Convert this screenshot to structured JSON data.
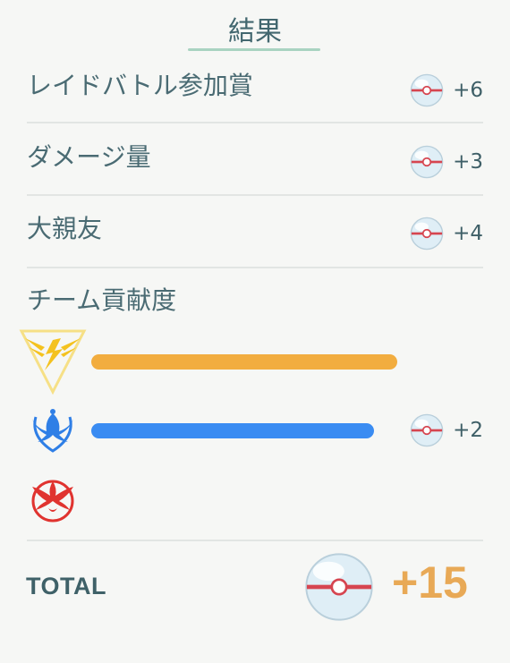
{
  "header": {
    "title": "結果"
  },
  "rows": [
    {
      "label": "レイドバトル参加賞",
      "amount": "+6",
      "icon": "premier-ball-icon"
    },
    {
      "label": "ダメージ量",
      "amount": "+3",
      "icon": "premier-ball-icon"
    },
    {
      "label": "大親友",
      "amount": "+4",
      "icon": "premier-ball-icon"
    }
  ],
  "team_section": {
    "label": "チーム貢献度",
    "teams": [
      {
        "icon": "team-instinct-icon",
        "color": "#f2ad3f",
        "contribution": 1.0,
        "amount": ""
      },
      {
        "icon": "team-mystic-icon",
        "color": "#3a8cf2",
        "contribution": 0.925,
        "amount": "+2"
      },
      {
        "icon": "team-valor-icon",
        "color": "#e0332f",
        "contribution": 0,
        "amount": ""
      }
    ]
  },
  "total": {
    "label": "TOTAL",
    "value": "+15",
    "icon": "premier-ball-icon"
  },
  "colors": {
    "background": "#f6f7f5",
    "text": "#4a6b73",
    "accent_underline": "#a9d3c1",
    "total_value": "#e8a956",
    "divider": "#e2e5e3"
  }
}
